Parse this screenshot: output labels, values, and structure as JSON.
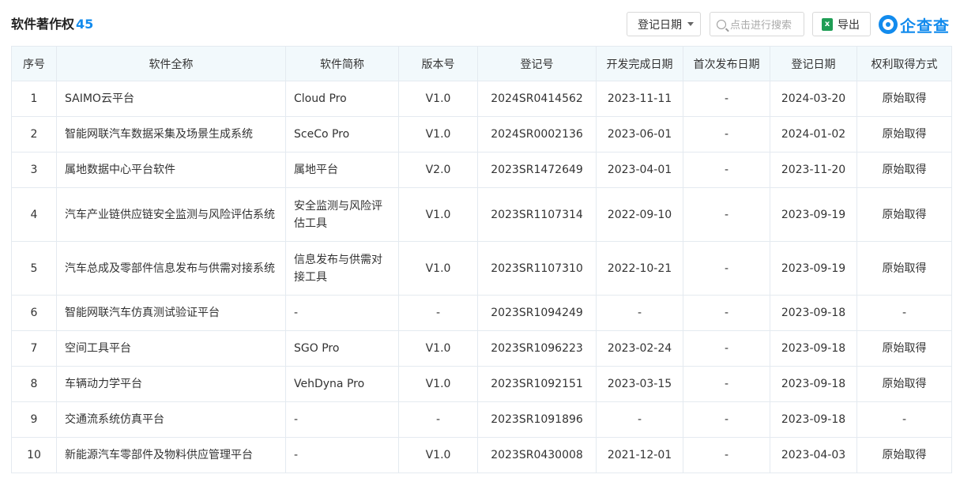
{
  "header": {
    "title": "软件著作权",
    "count": "45",
    "date_filter_label": "登记日期",
    "search_placeholder": "点击进行搜索",
    "export_label": "导出",
    "xls_glyph": "x",
    "logo_text": "企查查"
  },
  "table": {
    "columns": [
      "序号",
      "软件全称",
      "软件简称",
      "版本号",
      "登记号",
      "开发完成日期",
      "首次发布日期",
      "登记日期",
      "权利取得方式"
    ],
    "rows": [
      {
        "no": "1",
        "full_name": "SAIMO云平台",
        "short_name": "Cloud Pro",
        "version": "V1.0",
        "reg_no": "2024SR0414562",
        "dev_done": "2023-11-11",
        "first_pub": "-",
        "reg_date": "2024-03-20",
        "rights": "原始取得"
      },
      {
        "no": "2",
        "full_name": "智能网联汽车数据采集及场景生成系统",
        "short_name": "SceCo Pro",
        "version": "V1.0",
        "reg_no": "2024SR0002136",
        "dev_done": "2023-06-01",
        "first_pub": "-",
        "reg_date": "2024-01-02",
        "rights": "原始取得"
      },
      {
        "no": "3",
        "full_name": "属地数据中心平台软件",
        "short_name": "属地平台",
        "version": "V2.0",
        "reg_no": "2023SR1472649",
        "dev_done": "2023-04-01",
        "first_pub": "-",
        "reg_date": "2023-11-20",
        "rights": "原始取得"
      },
      {
        "no": "4",
        "full_name": "汽车产业链供应链安全监测与风险评估系统",
        "short_name": "安全监测与风险评估工具",
        "version": "V1.0",
        "reg_no": "2023SR1107314",
        "dev_done": "2022-09-10",
        "first_pub": "-",
        "reg_date": "2023-09-19",
        "rights": "原始取得"
      },
      {
        "no": "5",
        "full_name": "汽车总成及零部件信息发布与供需对接系统",
        "short_name": "信息发布与供需对接工具",
        "version": "V1.0",
        "reg_no": "2023SR1107310",
        "dev_done": "2022-10-21",
        "first_pub": "-",
        "reg_date": "2023-09-19",
        "rights": "原始取得"
      },
      {
        "no": "6",
        "full_name": "智能网联汽车仿真测试验证平台",
        "short_name": "-",
        "version": "-",
        "reg_no": "2023SR1094249",
        "dev_done": "-",
        "first_pub": "-",
        "reg_date": "2023-09-18",
        "rights": "-"
      },
      {
        "no": "7",
        "full_name": "空间工具平台",
        "short_name": "SGO Pro",
        "version": "V1.0",
        "reg_no": "2023SR1096223",
        "dev_done": "2023-02-24",
        "first_pub": "-",
        "reg_date": "2023-09-18",
        "rights": "原始取得"
      },
      {
        "no": "8",
        "full_name": "车辆动力学平台",
        "short_name": "VehDyna Pro",
        "version": "V1.0",
        "reg_no": "2023SR1092151",
        "dev_done": "2023-03-15",
        "first_pub": "-",
        "reg_date": "2023-09-18",
        "rights": "原始取得"
      },
      {
        "no": "9",
        "full_name": "交通流系统仿真平台",
        "short_name": "-",
        "version": "-",
        "reg_no": "2023SR1091896",
        "dev_done": "-",
        "first_pub": "-",
        "reg_date": "2023-09-18",
        "rights": "-"
      },
      {
        "no": "10",
        "full_name": "新能源汽车零部件及物料供应管理平台",
        "short_name": "-",
        "version": "V1.0",
        "reg_no": "2023SR0430008",
        "dev_done": "2021-12-01",
        "first_pub": "-",
        "reg_date": "2023-04-03",
        "rights": "原始取得"
      }
    ]
  },
  "colors": {
    "accent": "#128bed",
    "header_bg": "#f2f9fc",
    "border": "#e4eaf0",
    "excel_green": "#1f9d55"
  },
  "icons": {
    "date_caret": "caret-down-icon",
    "search": "search-icon",
    "export": "excel-icon",
    "logo": "qichacha-logo-icon"
  }
}
